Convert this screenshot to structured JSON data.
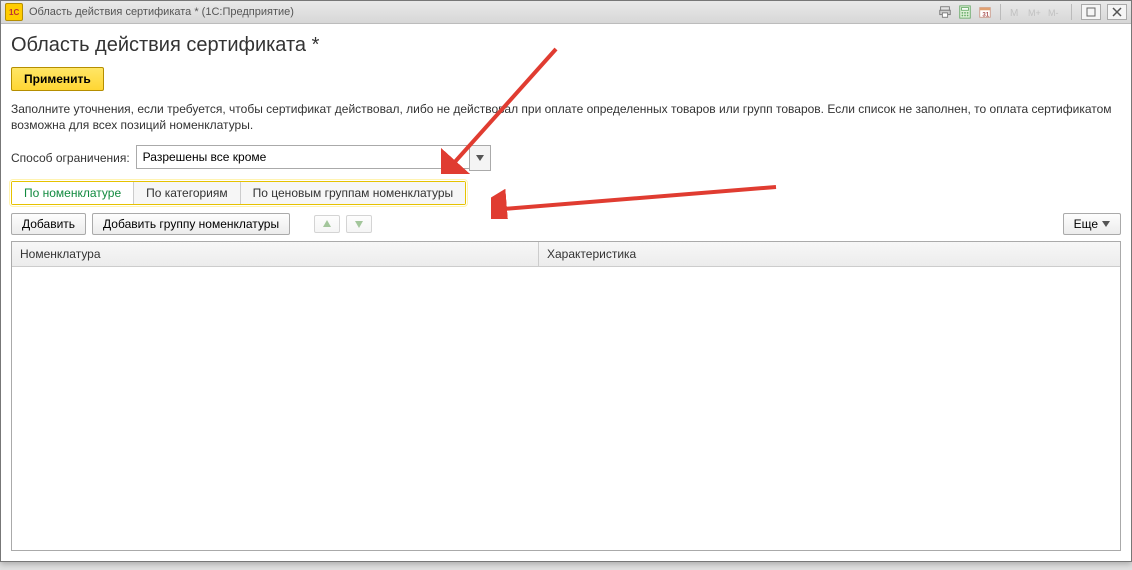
{
  "titlebar": {
    "logo_text": "1C",
    "title": "Область действия сертификата * (1С:Предприятие)"
  },
  "page": {
    "title": "Область действия сертификата *"
  },
  "apply": {
    "label": "Применить"
  },
  "description": "Заполните уточнения, если требуется, чтобы сертификат действовал, либо не действовал при оплате определенных товаров или групп товаров. Если список не заполнен, то оплата сертификатом возможна для всех позиций номенклатуры.",
  "restriction": {
    "label": "Способ ограничения:",
    "value": "Разрешены все кроме"
  },
  "tabs": {
    "items": [
      {
        "label": "По номенклатуре",
        "active": true
      },
      {
        "label": "По категориям",
        "active": false
      },
      {
        "label": "По ценовым группам номенклатуры",
        "active": false
      }
    ]
  },
  "toolbar": {
    "add": "Добавить",
    "add_group": "Добавить группу номенклатуры",
    "more": "Еще"
  },
  "table": {
    "columns": [
      "Номенклатура",
      "Характеристика"
    ],
    "rows": []
  }
}
